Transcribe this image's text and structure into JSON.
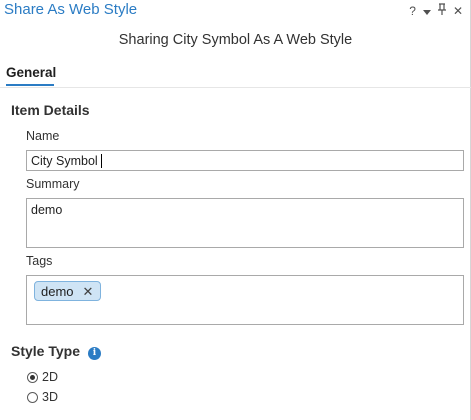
{
  "pane": {
    "title": "Share As Web Style",
    "controls": {
      "help": "?",
      "menu_icon": "chevron-down-icon",
      "pin": "ɨ",
      "close": "✕"
    }
  },
  "header": {
    "subtitle": "Sharing City Symbol As A Web Style"
  },
  "tabs": [
    {
      "label": "General",
      "selected": true
    }
  ],
  "item_details": {
    "section_title": "Item Details",
    "name": {
      "label": "Name",
      "value": "City Symbol"
    },
    "summary": {
      "label": "Summary",
      "value": "demo"
    },
    "tags": {
      "label": "Tags",
      "items": [
        "demo"
      ],
      "remove_glyph": "✕"
    }
  },
  "style_type": {
    "section_title": "Style Type",
    "info_icon": "info-icon",
    "options": [
      {
        "label": "2D",
        "checked": true
      },
      {
        "label": "3D",
        "checked": false
      }
    ]
  },
  "colors": {
    "accent": "#2b7cc4",
    "chip_bg": "#cfe4f5",
    "chip_border": "#7fb3de"
  }
}
